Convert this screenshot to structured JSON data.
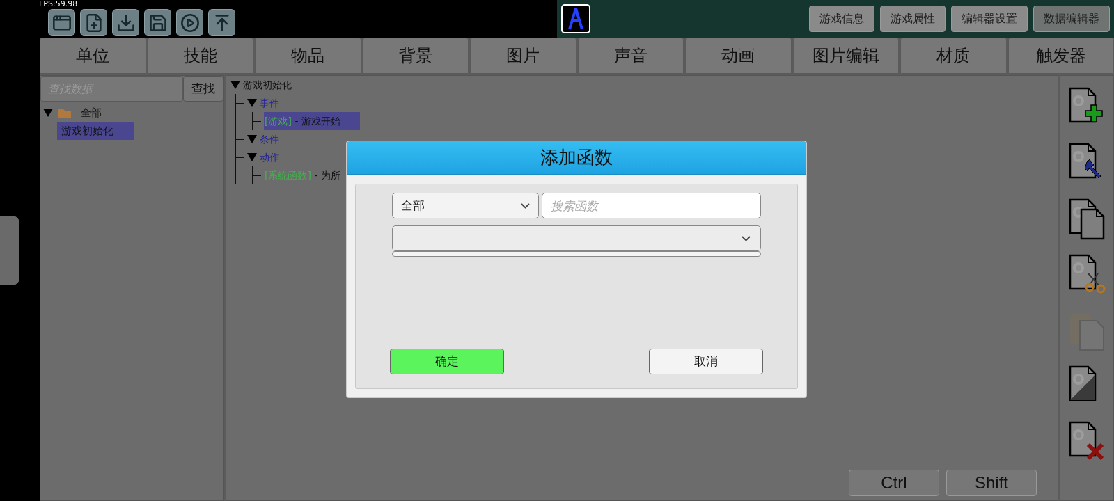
{
  "fps": "FPS:59.98",
  "toolbar_icons": [
    {
      "kind": "window"
    },
    {
      "kind": "new-file"
    },
    {
      "kind": "download"
    },
    {
      "kind": "save"
    },
    {
      "kind": "play"
    },
    {
      "kind": "upload"
    }
  ],
  "top_buttons": [
    {
      "label": "游戏信息",
      "selected": false
    },
    {
      "label": "游戏属性",
      "selected": false
    },
    {
      "label": "编辑器设置",
      "selected": false
    },
    {
      "label": "数据编辑器",
      "selected": true
    }
  ],
  "tabs": [
    {
      "label": "单位",
      "selected": false
    },
    {
      "label": "技能",
      "selected": false
    },
    {
      "label": "物品",
      "selected": false
    },
    {
      "label": "背景",
      "selected": false
    },
    {
      "label": "图片",
      "selected": false
    },
    {
      "label": "声音",
      "selected": false
    },
    {
      "label": "动画",
      "selected": false
    },
    {
      "label": "图片编辑",
      "selected": false
    },
    {
      "label": "材质",
      "selected": false
    },
    {
      "label": "触发器",
      "selected": false
    }
  ],
  "left_panel": {
    "search": {
      "placeholder": "查找数据"
    },
    "search_button": "查找",
    "tree": [
      {
        "label": "全部",
        "expanded": true,
        "selected": false,
        "children": [
          {
            "label": "游戏初始化",
            "selected": true
          }
        ]
      }
    ]
  },
  "trigger_tree": [
    {
      "label": "游戏初始化",
      "expanded": true,
      "kind": "root",
      "children": [
        {
          "label": "事件",
          "expanded": true,
          "kind": "section",
          "children": [
            {
              "tag": "[游戏]",
              "label": " - 游戏开始",
              "kind": "entry",
              "selected": true
            }
          ]
        },
        {
          "label": "条件",
          "expanded": true,
          "kind": "section"
        },
        {
          "label": "动作",
          "expanded": true,
          "kind": "section",
          "children": [
            {
              "tag": "[系统函数]",
              "label": " - 为所",
              "kind": "entry",
              "selected": false
            }
          ]
        }
      ]
    }
  ],
  "tools": [
    {
      "kind": "add",
      "disabled": false
    },
    {
      "kind": "edit",
      "disabled": false
    },
    {
      "kind": "copy",
      "disabled": false
    },
    {
      "kind": "cut",
      "disabled": false
    },
    {
      "kind": "paste",
      "disabled": true
    },
    {
      "kind": "toggle",
      "disabled": false
    },
    {
      "kind": "delete",
      "disabled": false
    }
  ],
  "keys": [
    "Ctrl",
    "Shift"
  ],
  "dialog": {
    "title": "添加函数",
    "category": "全部",
    "search": {
      "placeholder": "搜索函数"
    },
    "ok": "确定",
    "cancel": "取消"
  }
}
